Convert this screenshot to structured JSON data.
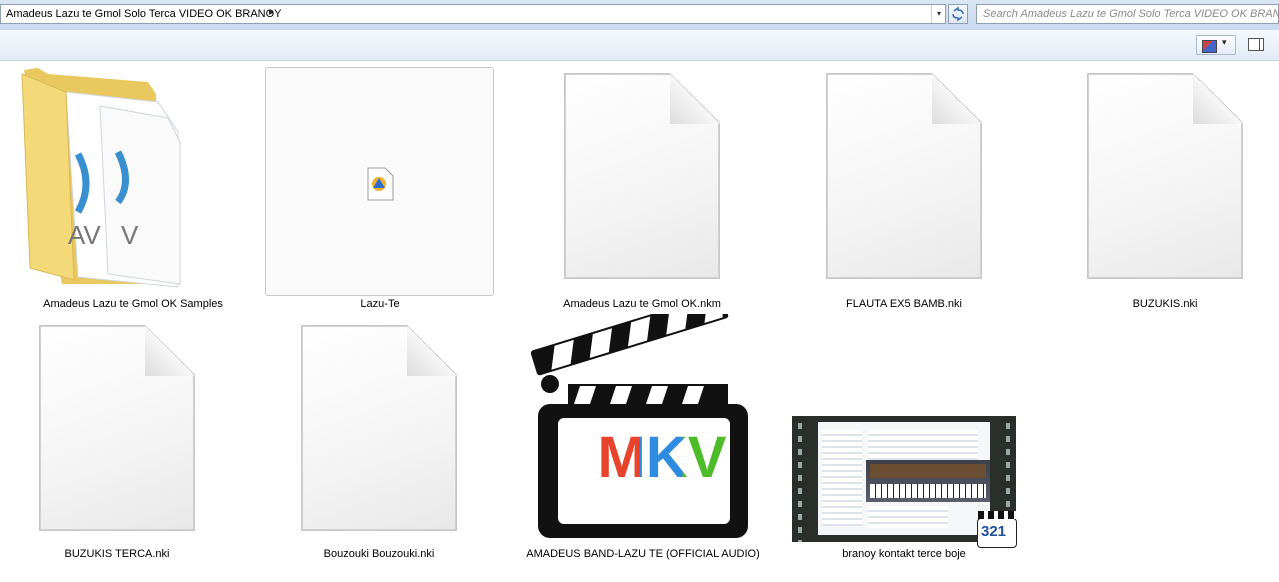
{
  "address_bar": {
    "path": "Amadeus Lazu te Gmol Solo Terca VIDEO OK BRANOY",
    "chevron": "▸",
    "dropdown": "▾"
  },
  "search": {
    "placeholder": "Search Amadeus Lazu te Gmol Solo Terca VIDEO OK BRANOY"
  },
  "toolbar": {
    "view_dropdown": "▾"
  },
  "thumb_mkv_text": "MKV",
  "badge_321": "321",
  "items": [
    {
      "label": "Amadeus Lazu te Gmol OK Samples",
      "icon": "folder-icon"
    },
    {
      "label": "Lazu-Te",
      "icon": "audio-file-icon"
    },
    {
      "label": "Amadeus Lazu te Gmol OK.nkm",
      "icon": "blank-file-icon"
    },
    {
      "label": "FLAUTA EX5 BAMB.nki",
      "icon": "blank-file-icon"
    },
    {
      "label": "BUZUKIS.nki",
      "icon": "blank-file-icon"
    },
    {
      "label": "BUZUKIS TERCA.nki",
      "icon": "blank-file-icon"
    },
    {
      "label": "Bouzouki Bouzouki.nki",
      "icon": "blank-file-icon"
    },
    {
      "label": "AMADEUS BAND-LAZU TE (OFFICIAL AUDIO)",
      "icon": "mkv-video-icon"
    },
    {
      "label": "branoy kontakt terce boje",
      "icon": "video-thumbnail"
    }
  ],
  "folder_overlay_text": [
    "AV",
    "V"
  ]
}
